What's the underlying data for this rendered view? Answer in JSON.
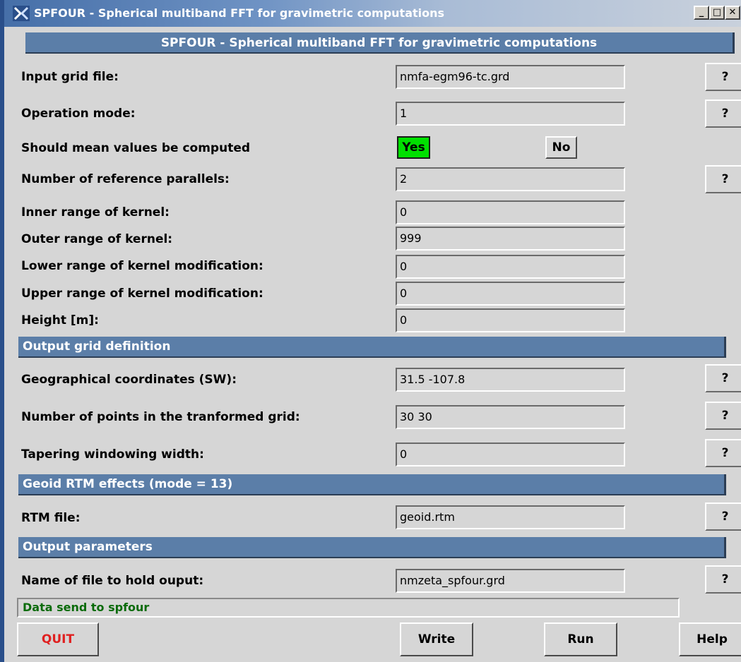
{
  "window": {
    "title": "SPFOUR - Spherical multiband FFT for gravimetric computations",
    "minimize_symbol": "_",
    "maximize_symbol": "□",
    "close_symbol": "✕",
    "icon": "app-icon"
  },
  "banner": {
    "text": "SPFOUR - Spherical multiband FFT for gravimetric computations"
  },
  "help_symbol": "?",
  "rows": {
    "input_grid": {
      "label": "Input grid file:",
      "value": "nmfa-egm96-tc.grd"
    },
    "operation_mode": {
      "label": "Operation mode:",
      "value": "1"
    },
    "mean_values": {
      "label": "Should mean values be computed",
      "yes": "Yes",
      "no": "No",
      "selected": "Yes"
    },
    "ref_parallels": {
      "label": "Number of reference parallels:",
      "value": "2"
    },
    "inner_range": {
      "label": "Inner range of kernel:",
      "value": "0"
    },
    "outer_range": {
      "label": "Outer range of kernel:",
      "value": "999"
    },
    "lower_mod": {
      "label": "Lower range of kernel modification:",
      "value": "0"
    },
    "upper_mod": {
      "label": "Upper range of kernel modification:",
      "value": "0"
    },
    "height": {
      "label": "Height [m]:",
      "value": "0"
    }
  },
  "sections": {
    "output_grid": "Output grid definition",
    "geoid_rtm": "Geoid RTM effects (mode = 13)",
    "output_params": "Output parameters"
  },
  "grid_rows": {
    "geo_coords": {
      "label": "Geographical coordinates (SW):",
      "value": "31.5 -107.8"
    },
    "num_points": {
      "label": "Number of points in the tranformed grid:",
      "value": "30 30"
    },
    "tapering": {
      "label": "Tapering windowing width:",
      "value": "0"
    }
  },
  "rtm": {
    "label": "RTM file:",
    "value": "geoid.rtm"
  },
  "output": {
    "label": "Name of file to hold ouput:",
    "value": "nmzeta_spfour.grd"
  },
  "status": {
    "text": "Data send to spfour"
  },
  "buttons": {
    "quit": "QUIT",
    "write": "Write",
    "run": "Run",
    "help": "Help"
  },
  "colors": {
    "selected_green": "#00e000",
    "section_blue": "#5b7ea8",
    "status_green": "#0a6b0a",
    "quit_red": "#e02020"
  }
}
